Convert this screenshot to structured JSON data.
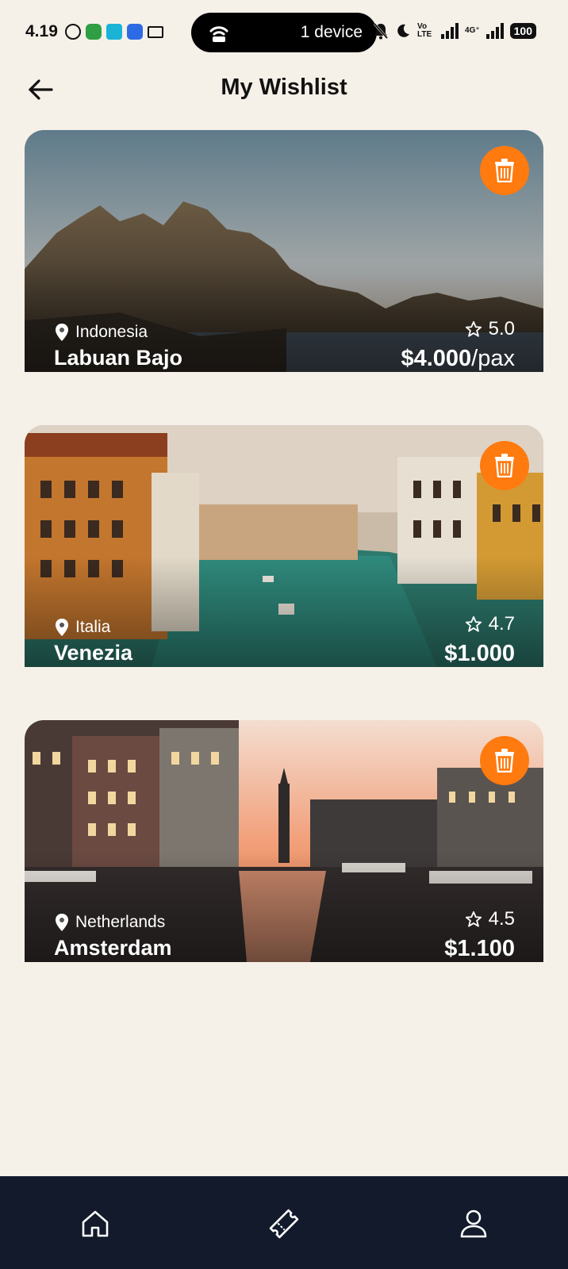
{
  "status_bar": {
    "time": "4.19",
    "hotspot_label": "1 device",
    "volte_tag": "Vo LTE",
    "network_tag": "4G⁺",
    "battery": "100"
  },
  "header": {
    "title": "My Wishlist",
    "back_icon": "arrow-left-icon"
  },
  "wishlist": [
    {
      "country": "Indonesia",
      "name": "Labuan Bajo",
      "rating": "5.0",
      "price": "$4.000",
      "price_unit": "/pax"
    },
    {
      "country": "Italia",
      "name": "Venezia",
      "rating": "4.7",
      "price": "$1.000",
      "price_unit": ""
    },
    {
      "country": "Netherlands",
      "name": "Amsterdam",
      "rating": "4.5",
      "price": "$1.100",
      "price_unit": ""
    }
  ],
  "bottom_nav": {
    "items": [
      "home-icon",
      "ticket-icon",
      "profile-icon"
    ]
  },
  "colors": {
    "background": "#f5f0e8",
    "accent": "#ff7a0f",
    "nav_background": "#121a2b"
  }
}
